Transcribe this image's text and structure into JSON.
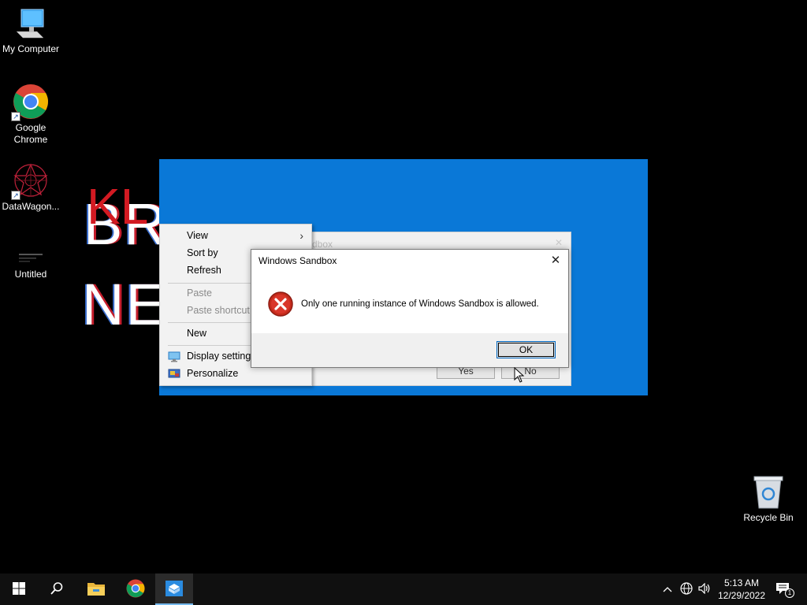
{
  "desktop": {
    "icons": [
      {
        "label": "My Computer",
        "icon": "computer-icon"
      },
      {
        "label": "Google\nChrome",
        "icon": "chrome-icon"
      },
      {
        "label": "DataWagon...",
        "icon": "datawagon-icon"
      },
      {
        "label": "Untitled",
        "icon": "untitled-file-icon"
      },
      {
        "label": "Recycle Bin",
        "icon": "recycle-bin-icon"
      }
    ],
    "wallpaper_text": {
      "line1": "BR",
      "line2": "NE",
      "red": "KL"
    }
  },
  "context_menu": {
    "items": [
      {
        "label": "View",
        "submenu": true,
        "disabled": false
      },
      {
        "label": "Sort by",
        "submenu": true,
        "disabled": false
      },
      {
        "label": "Refresh",
        "submenu": false,
        "disabled": false
      },
      {
        "label": "Paste",
        "submenu": false,
        "disabled": true
      },
      {
        "label": "Paste shortcut",
        "submenu": false,
        "disabled": true
      },
      {
        "label": "New",
        "submenu": true,
        "disabled": false
      },
      {
        "label": "Display settings",
        "submenu": false,
        "disabled": false,
        "icon": "display-settings-icon"
      },
      {
        "label": "Personalize",
        "submenu": false,
        "disabled": false,
        "icon": "personalize-icon"
      }
    ]
  },
  "background_dialog": {
    "title_fragment": "dbox",
    "yes_label": "Yes",
    "no_label": "No"
  },
  "dialog": {
    "title": "Windows Sandbox",
    "message": "Only one running instance of Windows Sandbox is allowed.",
    "ok_label": "OK",
    "icon": "error-icon"
  },
  "taskbar": {
    "apps": [
      "start-icon",
      "search-icon",
      "file-explorer-icon",
      "chrome-icon",
      "windows-sandbox-icon"
    ],
    "active_app": "windows-sandbox-icon",
    "clock_time": "5:13 AM",
    "clock_date": "12/29/2022",
    "notification_count": "1"
  },
  "colors": {
    "sandbox_blue": "#0a78d7",
    "error_red": "#c42b1c",
    "taskbar": "#101010"
  }
}
